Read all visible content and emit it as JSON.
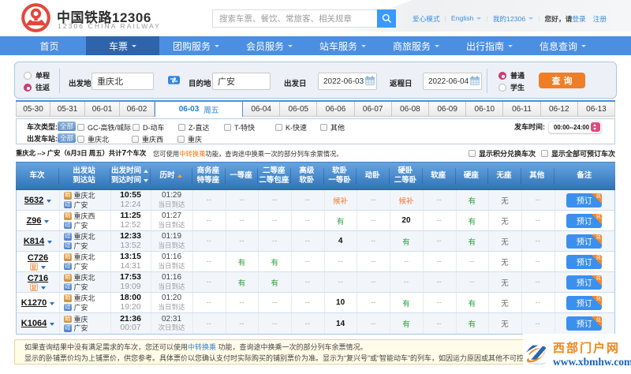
{
  "topbar": {
    "logo_title": "中国铁路12306",
    "logo_subtitle": "12306 CHINA RAILWAY",
    "search_placeholder": "搜索车票、餐饮、常旅客、相关规章",
    "care_mode": "爱心模式",
    "language": "English",
    "my12306": "我的12306",
    "greeting": "您好，请",
    "login": "登录",
    "register": "注册"
  },
  "nav": {
    "items": [
      {
        "label": "首页"
      },
      {
        "label": "车票"
      },
      {
        "label": "团购服务"
      },
      {
        "label": "会员服务"
      },
      {
        "label": "站车服务"
      },
      {
        "label": "商旅服务"
      },
      {
        "label": "出行指南"
      },
      {
        "label": "信息查询"
      }
    ],
    "active": "车票"
  },
  "search_form": {
    "one_way": "单程",
    "round_trip": "往返",
    "trip_selected": "往返",
    "from_label": "出发地",
    "from_value": "重庆北",
    "to_label": "目的地",
    "to_value": "广安",
    "depart_label": "出发日",
    "depart_value": "2022-06-03",
    "return_label": "返程日",
    "return_value": "2022-06-04",
    "normal": "普通",
    "student": "学生",
    "passenger_selected": "普通",
    "submit": "查询"
  },
  "date_tabs": {
    "tabs": [
      "05-30",
      "05-31",
      "06-01",
      "06-02",
      "06-03",
      "06-04",
      "06-05",
      "06-06",
      "06-07",
      "06-08",
      "06-09",
      "06-10",
      "06-11",
      "06-12",
      "06-13"
    ],
    "active": "06-03",
    "active_weekday": "周五"
  },
  "filters": {
    "train_type_label": "车次类型:",
    "train_type_all": "全部",
    "train_types": [
      "GC-高铁/城际",
      "D-动车",
      "Z-直达",
      "T-特快",
      "K-快速",
      "其他"
    ],
    "station_label": "出发车站:",
    "station_all": "全部",
    "stations": [
      "重庆北",
      "重庆西",
      "重庆"
    ],
    "depart_time_label": "发车时间:",
    "depart_time_value": "00:00--24:00"
  },
  "summary": {
    "route": "重庆北 --> 广安（6月3日  周五）共计",
    "count": "7",
    "count_suffix": "个车次",
    "tip_prefix": "您可使用",
    "tip_link": "中转换乘",
    "tip_suffix": "功能，查询途中换乘一次的部分列车余票情况。",
    "show_points": "显示积分兑换车次",
    "show_all": "显示全部可预订车次"
  },
  "table": {
    "headers": [
      {
        "l1": "车次"
      },
      {
        "l1": "出发站",
        "l2": "到达站"
      },
      {
        "l1": "出发时间",
        "l2": "到达时间"
      },
      {
        "l1": "历时"
      },
      {
        "l1": "商务座",
        "l2": "特等座"
      },
      {
        "l1": "一等座"
      },
      {
        "l1": "二等座",
        "l2": "二等包座"
      },
      {
        "l1": "高级",
        "l2": "软卧"
      },
      {
        "l1": "软卧",
        "l2": "一等卧"
      },
      {
        "l1": "动卧"
      },
      {
        "l1": "硬卧",
        "l2": "二等卧"
      },
      {
        "l1": "软座"
      },
      {
        "l1": "硬座"
      },
      {
        "l1": "无座"
      },
      {
        "l1": "其他"
      },
      {
        "l1": "备注"
      }
    ],
    "book_label": "预订",
    "book_badge": "兑",
    "fuxing_badge": "复",
    "rows": [
      {
        "train": "5632",
        "from_tag": "始",
        "from": "重庆北",
        "to_tag": "过",
        "to": "广安",
        "dep": "10:55",
        "arr": "12:24",
        "dur": "01:29",
        "day": "当日到达",
        "seats": [
          "--",
          "--",
          "--",
          "--",
          "候补",
          "--",
          "候补",
          "--",
          "有",
          "无",
          "--"
        ]
      },
      {
        "train": "Z96",
        "from_tag": "始",
        "from": "重庆西",
        "to_tag": "过",
        "to": "广安",
        "dep": "11:25",
        "arr": "12:52",
        "dur": "01:27",
        "day": "当日到达",
        "seats": [
          "--",
          "--",
          "--",
          "--",
          "有",
          "--",
          "20",
          "--",
          "有",
          "无",
          "--"
        ]
      },
      {
        "train": "K814",
        "from_tag": "过",
        "from": "重庆北",
        "to_tag": "过",
        "to": "广安",
        "dep": "12:33",
        "arr": "13:52",
        "dur": "01:19",
        "day": "当日到达",
        "seats": [
          "--",
          "--",
          "--",
          "--",
          "4",
          "--",
          "有",
          "--",
          "有",
          "无",
          "--"
        ]
      },
      {
        "train": "C726",
        "badge": "复",
        "from_tag": "始",
        "from": "重庆北",
        "to_tag": "过",
        "to": "广安",
        "dep": "13:15",
        "arr": "14:31",
        "dur": "01:16",
        "day": "当日到达",
        "seats": [
          "--",
          "有",
          "有",
          "--",
          "--",
          "--",
          "--",
          "--",
          "--",
          "无",
          "--"
        ]
      },
      {
        "train": "C716",
        "badge": "复",
        "from_tag": "始",
        "from": "重庆北",
        "to_tag": "过",
        "to": "广安",
        "dep": "17:53",
        "arr": "19:09",
        "dur": "01:16",
        "day": "当日到达",
        "seats": [
          "--",
          "有",
          "有",
          "--",
          "--",
          "--",
          "--",
          "--",
          "--",
          "无",
          "--"
        ]
      },
      {
        "train": "K1270",
        "from_tag": "始",
        "from": "重庆北",
        "to_tag": "过",
        "to": "广安",
        "dep": "18:00",
        "arr": "19:20",
        "dur": "01:20",
        "day": "当日到达",
        "seats": [
          "--",
          "--",
          "--",
          "--",
          "10",
          "--",
          "有",
          "--",
          "有",
          "无",
          "--"
        ]
      },
      {
        "train": "K1064",
        "from_tag": "始",
        "from": "重庆",
        "to_tag": "过",
        "to": "广安",
        "dep": "21:36",
        "arr": "00:07",
        "dur": "02:31",
        "day": "次日到达",
        "seats": [
          "--",
          "--",
          "--",
          "--",
          "14",
          "--",
          "有",
          "--",
          "有",
          "无",
          "--"
        ]
      }
    ]
  },
  "notice": {
    "line1_prefix": "如果查询结果中没有满足需求的车次，您还可以使用",
    "line1_link": "中转换乘",
    "line1_suffix": " 功能，查询途中换乘一次的部分列车余票情况。",
    "line2": "显示的卧铺票价均为上铺票价，供您参考。具体票价以您确认支付时实际购买的铺别票价为准。显示为“复兴号”或“智能动车”的列车，如因运力原因或其他不可控因素导致列车调度调整时，"
  },
  "watermark": {
    "site_name": "西部门户网",
    "site_url": "www.xbmhw.com"
  }
}
